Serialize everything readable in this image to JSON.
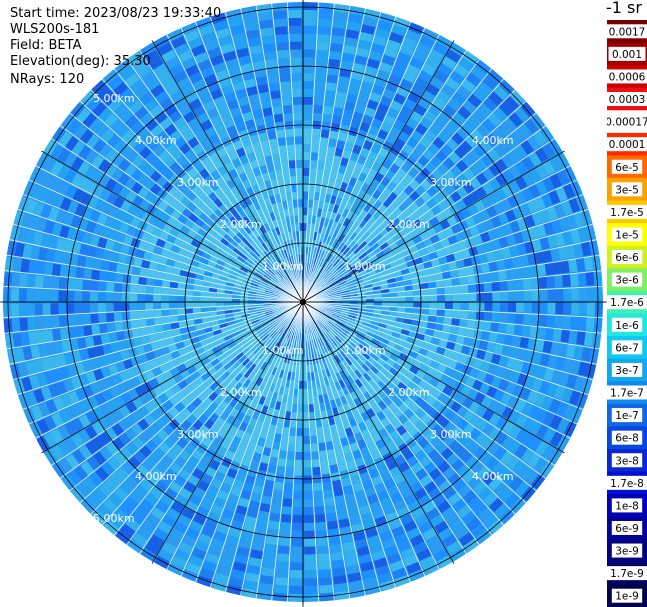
{
  "info": {
    "start_time": "Start time: 2023/08/23 19:33:40",
    "instrument": "WLS200s-181",
    "field": "Field: BETA",
    "elevation": "Elevation(deg): 35.30",
    "nrays": "NRays: 120"
  },
  "colorbar": {
    "unit_label": "-1 sr",
    "labels": [
      "0.0017",
      "0.001",
      "0.0006",
      "0.0003",
      "0.00017",
      "0.0001",
      "6e-5",
      "3e-5",
      "1.7e-5",
      "1e-5",
      "6e-6",
      "3e-6",
      "1.7e-6",
      "1e-6",
      "6e-7",
      "3e-7",
      "1.7e-7",
      "1e-7",
      "6e-8",
      "3e-8",
      "1.7e-8",
      "1e-8",
      "6e-9",
      "3e-9",
      "1.7e-9",
      "1e-9"
    ],
    "colors": [
      "#7a0000",
      "#a00000",
      "#cc0000",
      "#ee1010",
      "#ffffff",
      "#ff2a00",
      "#ff6a00",
      "#ffa000",
      "#ffcc00",
      "#ffff00",
      "#d0f020",
      "#80f060",
      "#40f0b0",
      "#20e8e0",
      "#10c8f0",
      "#10a8f0",
      "#1088ee",
      "#1068e8",
      "#0848e0",
      "#0828d8",
      "#0010d0",
      "#0000b8",
      "#00009c",
      "#000080",
      "#000066",
      "#00004c"
    ]
  },
  "plot": {
    "range_labels": [
      "1.00km",
      "2.00km",
      "3.00km",
      "4.00km",
      "5.00km"
    ],
    "background_colors": [
      "#1e90ff",
      "#29a0f4",
      "#35b0ee",
      "#1f7ff0",
      "#2c9cf0",
      "#1760e6",
      "#3bb8ee",
      "#26a2f2"
    ]
  }
}
